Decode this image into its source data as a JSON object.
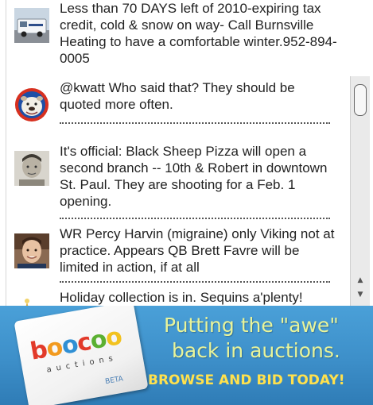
{
  "tweets": [
    {
      "avatar": "van-icon",
      "text": "Less than 70 DAYS left of 2010-expiring tax credit, cold & snow on way- Call Burnsville Heating to have a comfortable winter.952-894-0005"
    },
    {
      "avatar": "bulldog-icon",
      "text": "@kwatt Who said that? They should be quoted more often."
    },
    {
      "avatar": "boy-portrait-icon",
      "text": "It's official: Black Sheep Pizza will open a second branch -- 10th & Robert in downtown St. Paul. They are shooting for a Feb. 1 opening."
    },
    {
      "avatar": "player-portrait-icon",
      "text": "WR Percy Harvin (migraine) only Viking not at practice. Appears QB Brett Favre will be limited in action, if at all"
    },
    {
      "avatar": "ornament-icon",
      "text": "Holiday collection is in. Sequins a'plenty!"
    }
  ],
  "scrollbar": {
    "up": "▲",
    "down": "▼"
  },
  "ad": {
    "logo_letters": [
      "b",
      "o",
      "o",
      "c",
      "o",
      "o"
    ],
    "logo_colors": [
      "#e23a2a",
      "#f29a1f",
      "#2f8fd4",
      "#e23a2a",
      "#5bb031",
      "#f2c21f"
    ],
    "logo_sub": "auctions",
    "logo_beta": "BETA",
    "headline_1": "Putting the \"awe\"",
    "headline_2": "back in auctions.",
    "cta": "BROWSE AND BID TODAY!"
  }
}
